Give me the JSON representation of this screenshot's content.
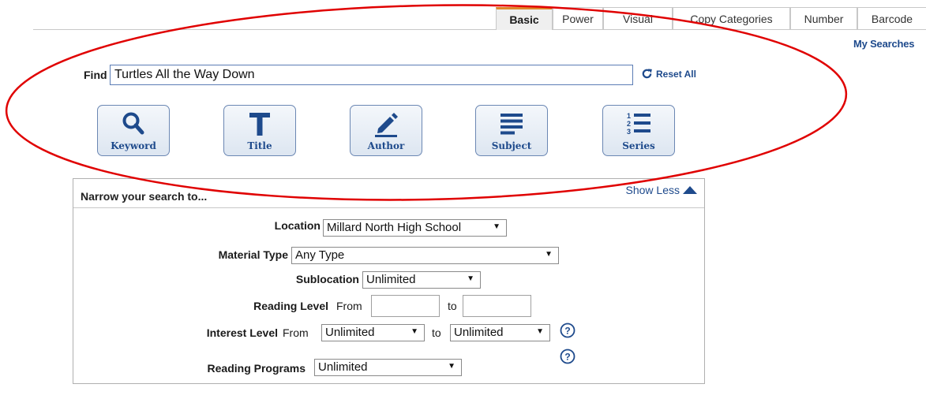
{
  "tabs": [
    {
      "label": "Basic"
    },
    {
      "label": "Power"
    },
    {
      "label": "Visual"
    },
    {
      "label": "Copy Categories"
    },
    {
      "label": "Number"
    },
    {
      "label": "Barcode"
    }
  ],
  "my_searches": "My Searches",
  "find": {
    "label": "Find",
    "value": "Turtles All the Way Down",
    "reset_label": "Reset All"
  },
  "search_types": [
    {
      "label": "Keyword",
      "icon": "search-icon"
    },
    {
      "label": "Title",
      "icon": "title-t-icon"
    },
    {
      "label": "Author",
      "icon": "pencil-icon"
    },
    {
      "label": "Subject",
      "icon": "lines-icon"
    },
    {
      "label": "Series",
      "icon": "numbered-list-icon"
    }
  ],
  "narrow": {
    "title": "Narrow your search to...",
    "show_less": "Show Less",
    "location": {
      "label": "Location",
      "value": "Millard North High School"
    },
    "material_type": {
      "label": "Material Type",
      "value": "Any Type"
    },
    "sublocation": {
      "label": "Sublocation",
      "value": "Unlimited"
    },
    "reading_level": {
      "label": "Reading Level",
      "from": "From",
      "to": "to"
    },
    "interest_level": {
      "label": "Interest Level",
      "from": "From",
      "from_value": "Unlimited",
      "to": "to",
      "to_value": "Unlimited"
    },
    "reading_programs": {
      "label": "Reading Programs",
      "value": "Unlimited"
    }
  },
  "colors": {
    "accent_tab": "#e0882b",
    "link": "#1e4a8c",
    "annotation": "#e00000"
  }
}
